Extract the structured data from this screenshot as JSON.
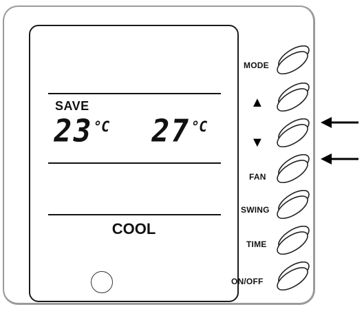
{
  "display": {
    "status_text": "SAVE",
    "set_temp": "23",
    "room_temp": "27",
    "temp_unit": "°C",
    "mode": "COOL"
  },
  "buttons": {
    "mode": "MODE",
    "up": "▲",
    "down": "▼",
    "fan": "FAN",
    "swing": "SWING",
    "time": "TIME",
    "power": "ON/OFF"
  }
}
